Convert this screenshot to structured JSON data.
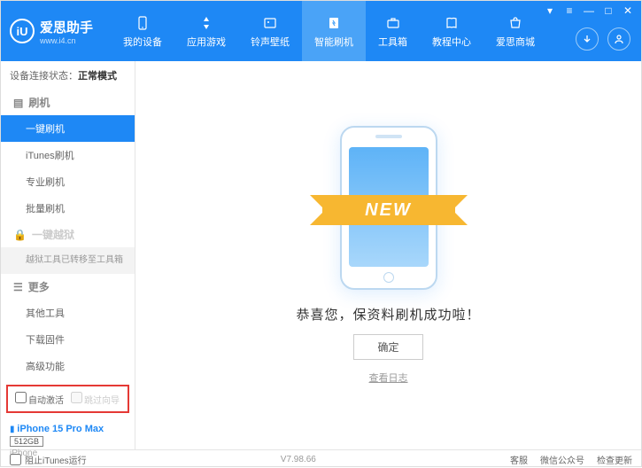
{
  "header": {
    "logo_letter": "iU",
    "app_name": "爱思助手",
    "app_url": "www.i4.cn",
    "nav": [
      {
        "label": "我的设备"
      },
      {
        "label": "应用游戏"
      },
      {
        "label": "铃声壁纸"
      },
      {
        "label": "智能刷机"
      },
      {
        "label": "工具箱"
      },
      {
        "label": "教程中心"
      },
      {
        "label": "爱思商城"
      }
    ]
  },
  "sidebar": {
    "conn_label": "设备连接状态：",
    "conn_value": "正常模式",
    "section_flash": "刷机",
    "items_flash": [
      "一键刷机",
      "iTunes刷机",
      "专业刷机",
      "批量刷机"
    ],
    "section_jailbreak": "一键越狱",
    "jailbreak_note": "越狱工具已转移至工具箱",
    "section_more": "更多",
    "items_more": [
      "其他工具",
      "下载固件",
      "高级功能"
    ],
    "checkbox_auto_activate": "自动激活",
    "checkbox_skip_guide": "跳过向导",
    "device_name": "iPhone 15 Pro Max",
    "device_storage": "512GB",
    "device_type": "iPhone"
  },
  "main": {
    "new_text": "NEW",
    "success": "恭喜您，保资料刷机成功啦！",
    "ok": "确定",
    "view_log": "查看日志"
  },
  "footer": {
    "block_itunes": "阻止iTunes运行",
    "version": "V7.98.66",
    "links": [
      "客服",
      "微信公众号",
      "检查更新"
    ]
  }
}
